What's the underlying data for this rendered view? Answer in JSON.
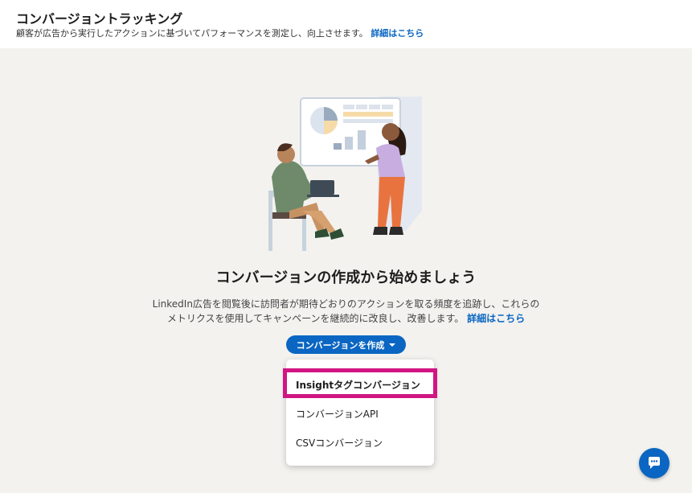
{
  "header": {
    "title": "コンバージョントラッキング",
    "subtitle": "顧客が広告から実行したアクションに基づいてパフォーマンスを測定し、向上させます。",
    "learn_more": "詳細はこちら"
  },
  "main": {
    "title": "コンバージョンの作成から始めましょう",
    "description": "LinkedIn広告を閲覧後に訪問者が期待どおりのアクションを取る頻度を追跡し、これらのメトリクスを使用してキャンペーンを継続的に改良し、改善します。",
    "learn_more": "詳細はこちら"
  },
  "create_button": {
    "label": "コンバージョンを作成",
    "icon": "caret-down-icon"
  },
  "dropdown": {
    "items": [
      {
        "label": "Insightタグコンバージョン"
      },
      {
        "label": "コンバージョンAPI"
      },
      {
        "label": "CSVコンバージョン"
      }
    ]
  },
  "colors": {
    "brand": "#0a66c2",
    "highlight": "#d11583",
    "background": "#f3f2ef"
  },
  "chat": {
    "icon": "chat-bubble-icon"
  }
}
